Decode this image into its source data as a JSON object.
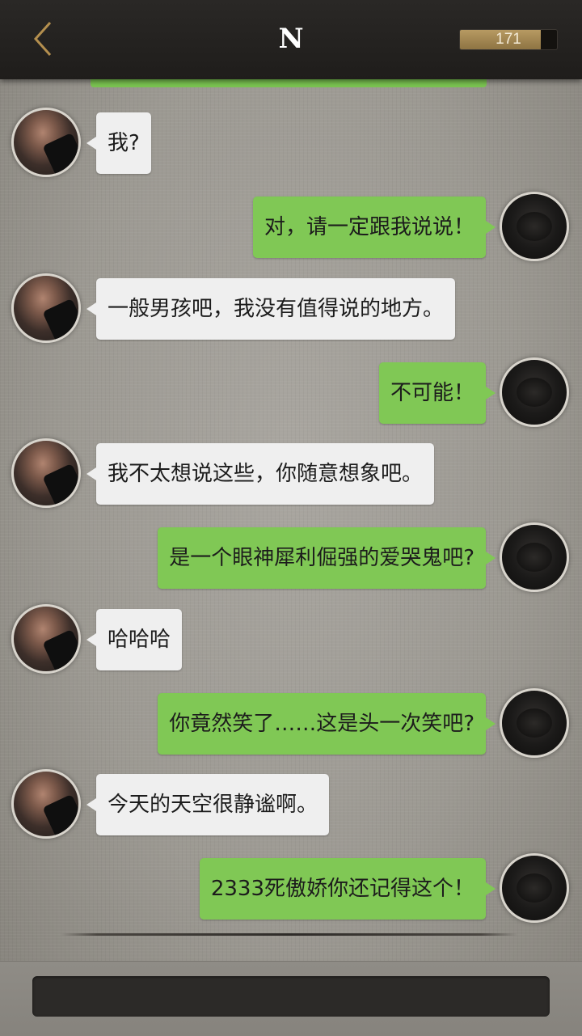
{
  "header": {
    "title": "N",
    "back_icon": "chevron-left-icon",
    "coins": {
      "value": "171",
      "fill_fraction": 0.83
    }
  },
  "colors": {
    "header_bg": "#1f1d1b",
    "accent_gold": "#b48f4e",
    "outgoing_bubble": "#80c855",
    "incoming_bubble": "#efefef",
    "chat_bg": "#9c9992"
  },
  "messages": [
    {
      "from": "them",
      "text": "我?"
    },
    {
      "from": "me",
      "text": "对，请一定跟我说说！"
    },
    {
      "from": "them",
      "text": "一般男孩吧，我没有值得说的地方。"
    },
    {
      "from": "me",
      "text": "不可能！"
    },
    {
      "from": "them",
      "text": "我不太想说这些，你随意想象吧。"
    },
    {
      "from": "me",
      "text": "是一个眼神犀利倔强的爱哭鬼吧?"
    },
    {
      "from": "them",
      "text": "哈哈哈"
    },
    {
      "from": "me",
      "text": "你竟然笑了……这是头一次笑吧?"
    },
    {
      "from": "them",
      "text": "今天的天空很静谧啊。"
    },
    {
      "from": "me",
      "text": "2333死傲娇你还记得这个！"
    }
  ]
}
